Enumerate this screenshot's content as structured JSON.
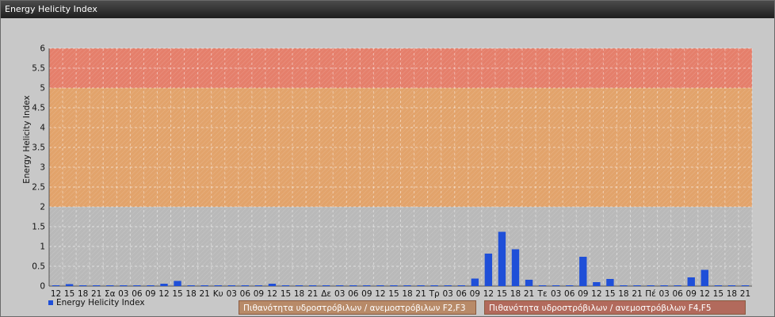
{
  "window": {
    "title": "Energy Helicity Index"
  },
  "colors": {
    "band_low": "#b9b9b9",
    "band_mid": "#e2a36b",
    "band_high": "#e57f6b",
    "bar": "#1f4fd8"
  },
  "chart_data": {
    "type": "bar",
    "title": "",
    "ylabel": "Energy Helicity Index",
    "xlabel": "",
    "ylim": [
      0,
      6
    ],
    "yticks": [
      "0",
      "0.5",
      "1",
      "1.5",
      "2",
      "2.5",
      "3",
      "3.5",
      "4",
      "4.5",
      "5",
      "5.5",
      "6"
    ],
    "grid": true,
    "legend_position": "bottom-left",
    "categories": [
      "12",
      "15",
      "18",
      "21",
      "Σα",
      "03",
      "06",
      "09",
      "12",
      "15",
      "18",
      "21",
      "Κυ",
      "03",
      "06",
      "09",
      "12",
      "15",
      "18",
      "21",
      "Δε",
      "03",
      "06",
      "09",
      "12",
      "15",
      "18",
      "21",
      "Τρ",
      "03",
      "06",
      "09",
      "12",
      "15",
      "18",
      "21",
      "Τε",
      "03",
      "06",
      "09",
      "12",
      "15",
      "18",
      "21",
      "Πέ",
      "03",
      "06",
      "09",
      "12",
      "15",
      "18",
      "21"
    ],
    "series": [
      {
        "name": "Energy Helicity Index",
        "values": [
          0.02,
          0.05,
          0.02,
          0.02,
          0.02,
          0.02,
          0.02,
          0.02,
          0.06,
          0.13,
          0.02,
          0.02,
          0.02,
          0.02,
          0.02,
          0.02,
          0.06,
          0.02,
          0.02,
          0.02,
          0.02,
          0.02,
          0.02,
          0.02,
          0.02,
          0.02,
          0.02,
          0.02,
          0.02,
          0.02,
          0.02,
          0.19,
          0.82,
          1.37,
          0.93,
          0.16,
          0.02,
          0.02,
          0.02,
          0.74,
          0.1,
          0.18,
          0.02,
          0.02,
          0.02,
          0.02,
          0.02,
          0.22,
          0.41,
          0.02,
          0.02,
          0.02
        ]
      }
    ],
    "bands": [
      {
        "from": 0,
        "to": 2,
        "color": "#b9b9b9",
        "label": ""
      },
      {
        "from": 2,
        "to": 5,
        "color": "#e2a36b",
        "label": "Πιθανότητα υδροστρόβιλων / ανεμοστρόβιλων F2,F3"
      },
      {
        "from": 5,
        "to": 6,
        "color": "#e57f6b",
        "label": "Πιθανότητα υδροστρόβιλων / ανεμοστρόβιλων F4,F5"
      }
    ]
  }
}
